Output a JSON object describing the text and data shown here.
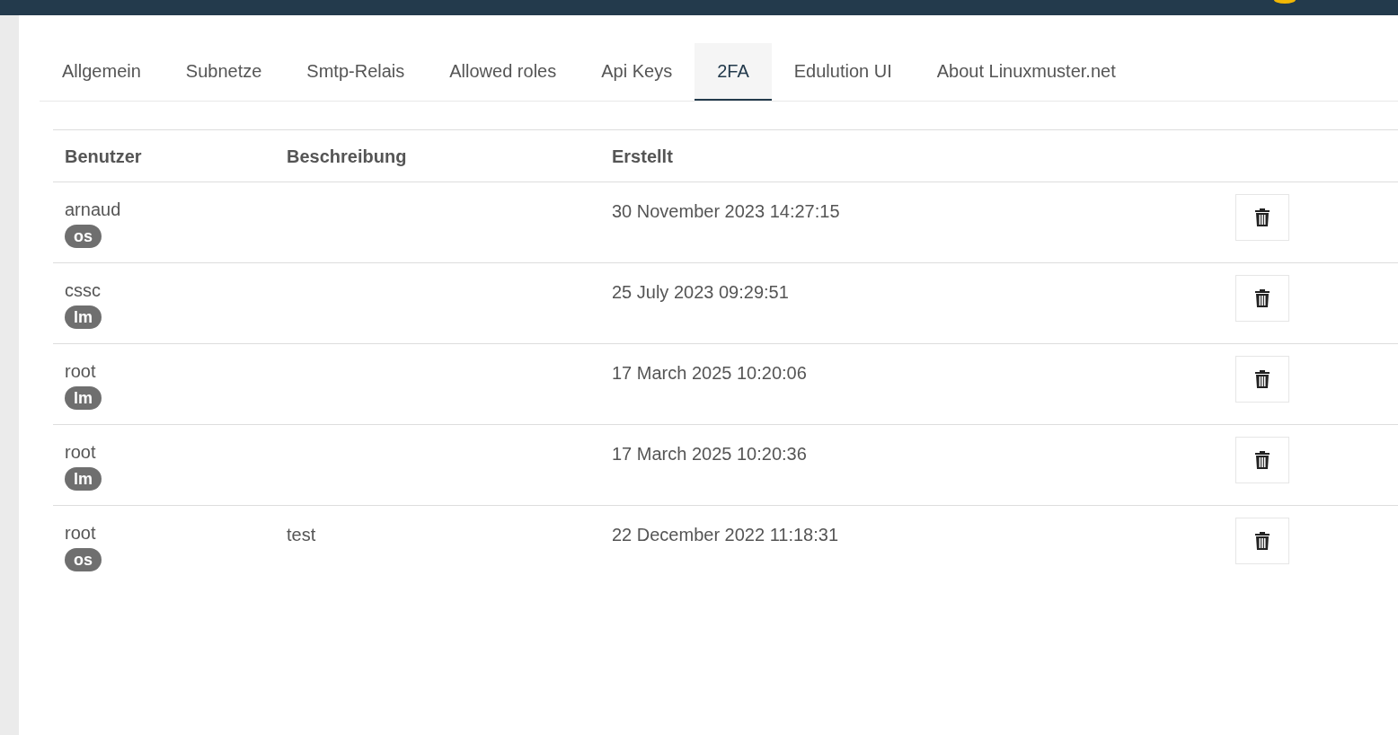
{
  "tabs": [
    {
      "label": "Allgemein",
      "selected": false
    },
    {
      "label": "Subnetze",
      "selected": false
    },
    {
      "label": "Smtp-Relais",
      "selected": false
    },
    {
      "label": "Allowed roles",
      "selected": false
    },
    {
      "label": "Api Keys",
      "selected": false
    },
    {
      "label": "2FA",
      "selected": true
    },
    {
      "label": "Edulution UI",
      "selected": false
    },
    {
      "label": "About Linuxmuster.net",
      "selected": false
    }
  ],
  "table": {
    "columns": [
      "Benutzer",
      "Beschreibung",
      "Erstellt"
    ],
    "rows": [
      {
        "user": "arnaud",
        "badge": "os",
        "created": "30 November 2023 14:27:15"
      },
      {
        "user": "cssc",
        "badge": "lm",
        "created": "25 July 2023 09:29:51"
      },
      {
        "user": "root",
        "badge": "lm",
        "created": "17 March 2025 10:20:06"
      },
      {
        "user": "root",
        "badge": "lm",
        "created": "17 March 2025 10:20:36"
      },
      {
        "user": "root",
        "badge": "os",
        "description": "test",
        "created": "22 December 2022 11:18:31"
      }
    ]
  }
}
